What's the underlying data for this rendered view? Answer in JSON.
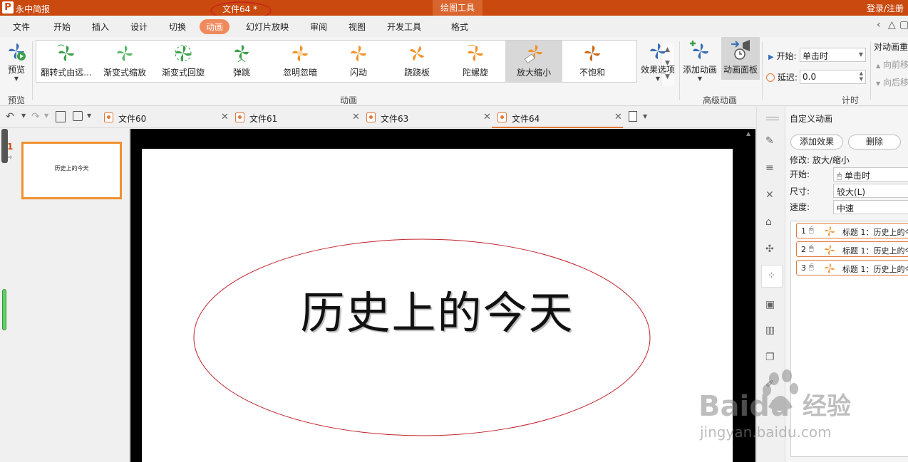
{
  "titlebar": {
    "app_name": "永中简报",
    "doc_title": "文件64 *",
    "context_tab": "绘图工具",
    "login": "登录/注册"
  },
  "menu": {
    "tabs": [
      "文件",
      "开始",
      "插入",
      "设计",
      "切换",
      "动画",
      "幻灯片放映",
      "审阅",
      "视图",
      "开发工具",
      "格式"
    ],
    "active": "动画"
  },
  "ribbon": {
    "preview_label": "预览",
    "preview_group": "预览",
    "gallery_items": [
      "翻转式由远...",
      "渐变式缩放",
      "渐变式回旋",
      "弹跳",
      "忽明忽暗",
      "闪动",
      "跷跷板",
      "陀螺旋",
      "放大缩小",
      "不饱和"
    ],
    "gallery_selected": "放大缩小",
    "effect_options": "效果选项",
    "animation_group": "动画",
    "add_animation": "添加动画",
    "animation_pane": "动画面板",
    "advanced_group": "高级动画",
    "start_label": "开始:",
    "start_value": "单击时",
    "delay_label": "延迟:",
    "delay_value": "0.0",
    "timing_group": "计时",
    "reorder_title": "对动画重",
    "move_earlier": "向前移",
    "move_later": "向后移",
    "colors": {
      "green": "#3aa04a",
      "orange": "#f2932a",
      "blue": "#3a6fb8"
    }
  },
  "doc_tabs": [
    {
      "label": "文件60",
      "active": false
    },
    {
      "label": "文件61",
      "active": false
    },
    {
      "label": "文件63",
      "active": false
    },
    {
      "label": "文件64",
      "active": true
    }
  ],
  "thumbs": {
    "slide_number": "1",
    "slide_title": "历史上的今天"
  },
  "slide": {
    "title": "历史上的今天"
  },
  "panel": {
    "title": "自定义动画",
    "add_effect": "添加效果",
    "delete": "删除",
    "modify": "修改: 放大/缩小",
    "start_label": "开始:",
    "start_value": "单击时",
    "size_label": "尺寸:",
    "size_value": "较大(L)",
    "speed_label": "速度:",
    "speed_value": "中速",
    "items": [
      {
        "num": "1",
        "text": "标题 1：历史上的今"
      },
      {
        "num": "2",
        "text": "标题 1：历史上的今"
      },
      {
        "num": "3",
        "text": "标题 1：历史上的今"
      }
    ]
  },
  "watermark": {
    "brand": "Baidu",
    "brand_cn": "经验",
    "url": "jingyan.baidu.com"
  }
}
